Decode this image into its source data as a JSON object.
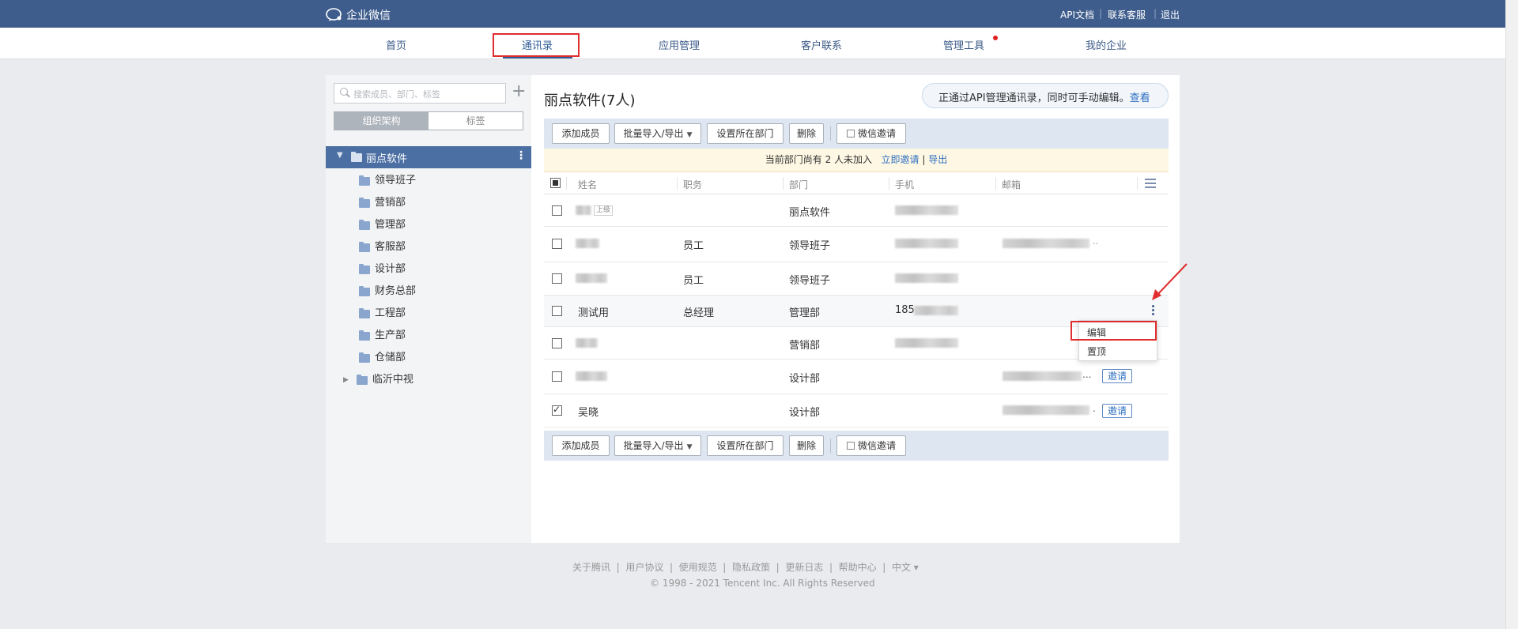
{
  "app": {
    "logo_text": "企业微信"
  },
  "top_links": {
    "api_docs": "API文档",
    "support": "联系客服",
    "logout": "退出",
    "sep": "|"
  },
  "nav": [
    "首页",
    "通讯录",
    "应用管理",
    "客户联系",
    "管理工具",
    "我的企业"
  ],
  "nav_active": "通讯录",
  "sidebar": {
    "search_placeholder": "搜索成员、部门、标签",
    "add": "+",
    "tab_org": "组织架构",
    "tab_tags": "标签",
    "root": "丽点软件",
    "departments": [
      "领导班子",
      "营销部",
      "管理部",
      "客服部",
      "设计部",
      "财务总部",
      "工程部",
      "生产部",
      "仓储部"
    ],
    "collapsed_root": "临沂中视"
  },
  "content": {
    "title": "丽点软件(7人)",
    "api_notice": "正通过API管理通讯录，同时可手动编辑。",
    "api_notice_link": "查看",
    "toolbar": {
      "add_member": "添加成员",
      "bulk": "批量导入/导出",
      "set_dept": "设置所在部门",
      "delete": "删除",
      "wechat_invite": "微信邀请"
    },
    "notice": {
      "text": "当前部门尚有 2 人未加入",
      "invite_now": "立即邀请",
      "sep": "|",
      "export": "导出"
    },
    "columns": {
      "name": "姓名",
      "position": "职务",
      "department": "部门",
      "phone": "手机",
      "email": "邮箱"
    },
    "superior_tag": "上级",
    "rows": [
      {
        "name": "",
        "position": "",
        "department": "丽点软件",
        "phone": "",
        "email": ""
      },
      {
        "name": "",
        "position": "员工",
        "department": "领导班子",
        "phone": "",
        "email": ".."
      },
      {
        "name": "",
        "position": "员工",
        "department": "领导班子",
        "phone": "",
        "email": ""
      },
      {
        "name": "测试用",
        "position": "总经理",
        "department": "管理部",
        "phone": "185",
        "email": ""
      },
      {
        "name": "",
        "position": "",
        "department": "营销部",
        "phone": "",
        "email": ""
      },
      {
        "name": "",
        "position": "",
        "department": "设计部",
        "phone": "",
        "email": "...",
        "invite": "邀请"
      },
      {
        "name": "吴晓",
        "position": "",
        "department": "设计部",
        "phone": "",
        "email": ".",
        "invite": "邀请",
        "checked": true
      }
    ],
    "row_menu": {
      "edit": "编辑",
      "pin": "置顶"
    }
  },
  "footer": {
    "links": [
      "关于腾讯",
      "用户协议",
      "使用规范",
      "隐私政策",
      "更新日志",
      "帮助中心",
      "中文 ▾"
    ],
    "copyright": "© 1998 - 2021 Tencent Inc. All Rights Reserved"
  },
  "colors": {
    "topbar": "#3e5d8c",
    "accent": "#2e6fc1",
    "highlight": "#e02d2d"
  }
}
